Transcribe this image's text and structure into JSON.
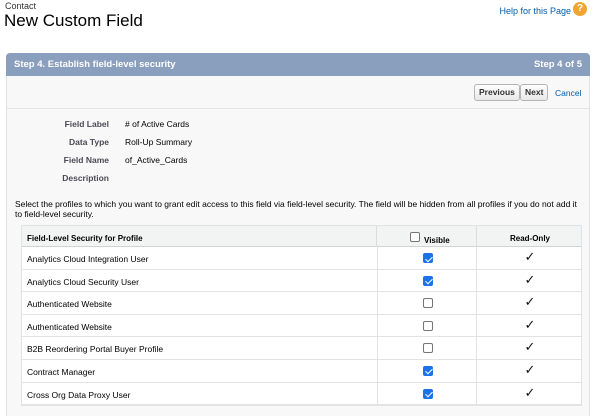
{
  "header": {
    "breadcrumb": "Contact",
    "title": "New Custom Field",
    "help_link": "Help for this Page",
    "help_icon": "question-mark-icon"
  },
  "step": {
    "title": "Step 4. Establish field-level security",
    "count": "Step 4 of 5"
  },
  "buttons": {
    "previous": "Previous",
    "next": "Next",
    "cancel": "Cancel"
  },
  "field_info": [
    {
      "label": "Field Label",
      "value": "# of Active Cards"
    },
    {
      "label": "Data Type",
      "value": "Roll-Up Summary"
    },
    {
      "label": "Field Name",
      "value": "of_Active_Cards"
    },
    {
      "label": "Description",
      "value": ""
    }
  ],
  "instructions": "Select the profiles to which you want to grant edit access to this field via field-level security. The field will be hidden from all profiles if you do not add it to field-level security.",
  "table": {
    "columns": {
      "profile": "Field-Level Security for Profile",
      "visible": "Visible",
      "read_only": "Read-Only"
    },
    "rows": [
      {
        "profile": "Analytics Cloud Integration User",
        "visible": true,
        "read_only": true
      },
      {
        "profile": "Analytics Cloud Security User",
        "visible": true,
        "read_only": true
      },
      {
        "profile": "Authenticated Website",
        "visible": false,
        "read_only": true
      },
      {
        "profile": "Authenticated Website",
        "visible": false,
        "read_only": true
      },
      {
        "profile": "B2B Reordering Portal Buyer Profile",
        "visible": false,
        "read_only": true
      },
      {
        "profile": "Contract Manager",
        "visible": true,
        "read_only": true
      },
      {
        "profile": "Cross Org Data Proxy User",
        "visible": true,
        "read_only": true
      }
    ],
    "checkmark_glyph": "✓"
  },
  "colors": {
    "step_header_bg": "#8a9ebe",
    "link": "#015ba7",
    "checkbox_checked": "#1a73e8",
    "help_icon": "#f0a431"
  }
}
